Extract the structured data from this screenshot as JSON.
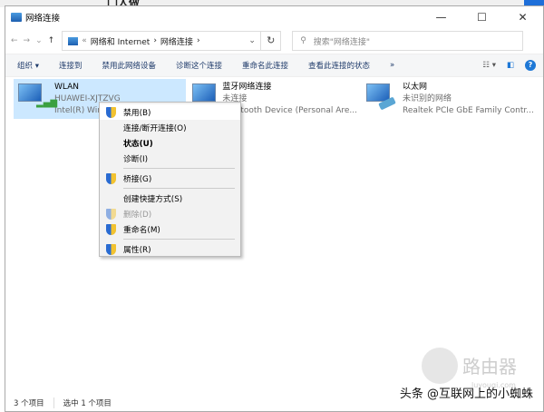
{
  "background_window": {
    "title_fragment": "门人做"
  },
  "window": {
    "title": "网络连接",
    "minimize": "—",
    "maximize": "☐",
    "close": "✕"
  },
  "nav": {
    "back": "←",
    "forward": "→",
    "recent": "⌄",
    "up": "↑",
    "breadcrumb_prefix": "«",
    "breadcrumb": [
      "网络和 Internet",
      "网络连接"
    ],
    "sep": "›",
    "dropdown": "⌄",
    "refresh": "↻",
    "search_icon": "⚲",
    "search_placeholder": "搜索\"网络连接\""
  },
  "toolbar": {
    "items": [
      "组织 ▾",
      "连接到",
      "禁用此网络设备",
      "诊断这个连接",
      "重命名此连接",
      "查看此连接的状态",
      "»"
    ],
    "view": "☷ ▾",
    "pane": "◧",
    "help": "?"
  },
  "connections": [
    {
      "name": "WLAN",
      "line2": "HUAWEI-XJTZVG",
      "line3": "Intel(R) Wireless",
      "selected": true,
      "type": "wifi"
    },
    {
      "name": "蓝牙网络连接",
      "line2": "未连接",
      "line3": "Bluetooth Device (Personal Are...",
      "selected": false,
      "type": "bluetooth"
    },
    {
      "name": "以太网",
      "line2": "未识别的网络",
      "line3": "Realtek PCIe GbE Family Contr...",
      "selected": false,
      "type": "ethernet"
    }
  ],
  "context_menu": [
    {
      "label": "禁用(B)",
      "shield": true,
      "highlight": true
    },
    {
      "label": "连接/断开连接(O)"
    },
    {
      "label": "状态(U)",
      "bold": true
    },
    {
      "label": "诊断(I)"
    },
    {
      "sep": true
    },
    {
      "label": "桥接(G)",
      "shield": true
    },
    {
      "sep": true
    },
    {
      "label": "创建快捷方式(S)"
    },
    {
      "label": "删除(D)",
      "shield": true,
      "disabled": true
    },
    {
      "label": "重命名(M)",
      "shield": true
    },
    {
      "sep": true
    },
    {
      "label": "属性(R)",
      "shield": true
    }
  ],
  "status": {
    "count": "3 个项目",
    "selected": "选中 1 个项目"
  },
  "watermark": {
    "author": "头条 @互联网上的小蜘蛛",
    "logo": "路由器",
    "site": "luyouqi.com"
  }
}
